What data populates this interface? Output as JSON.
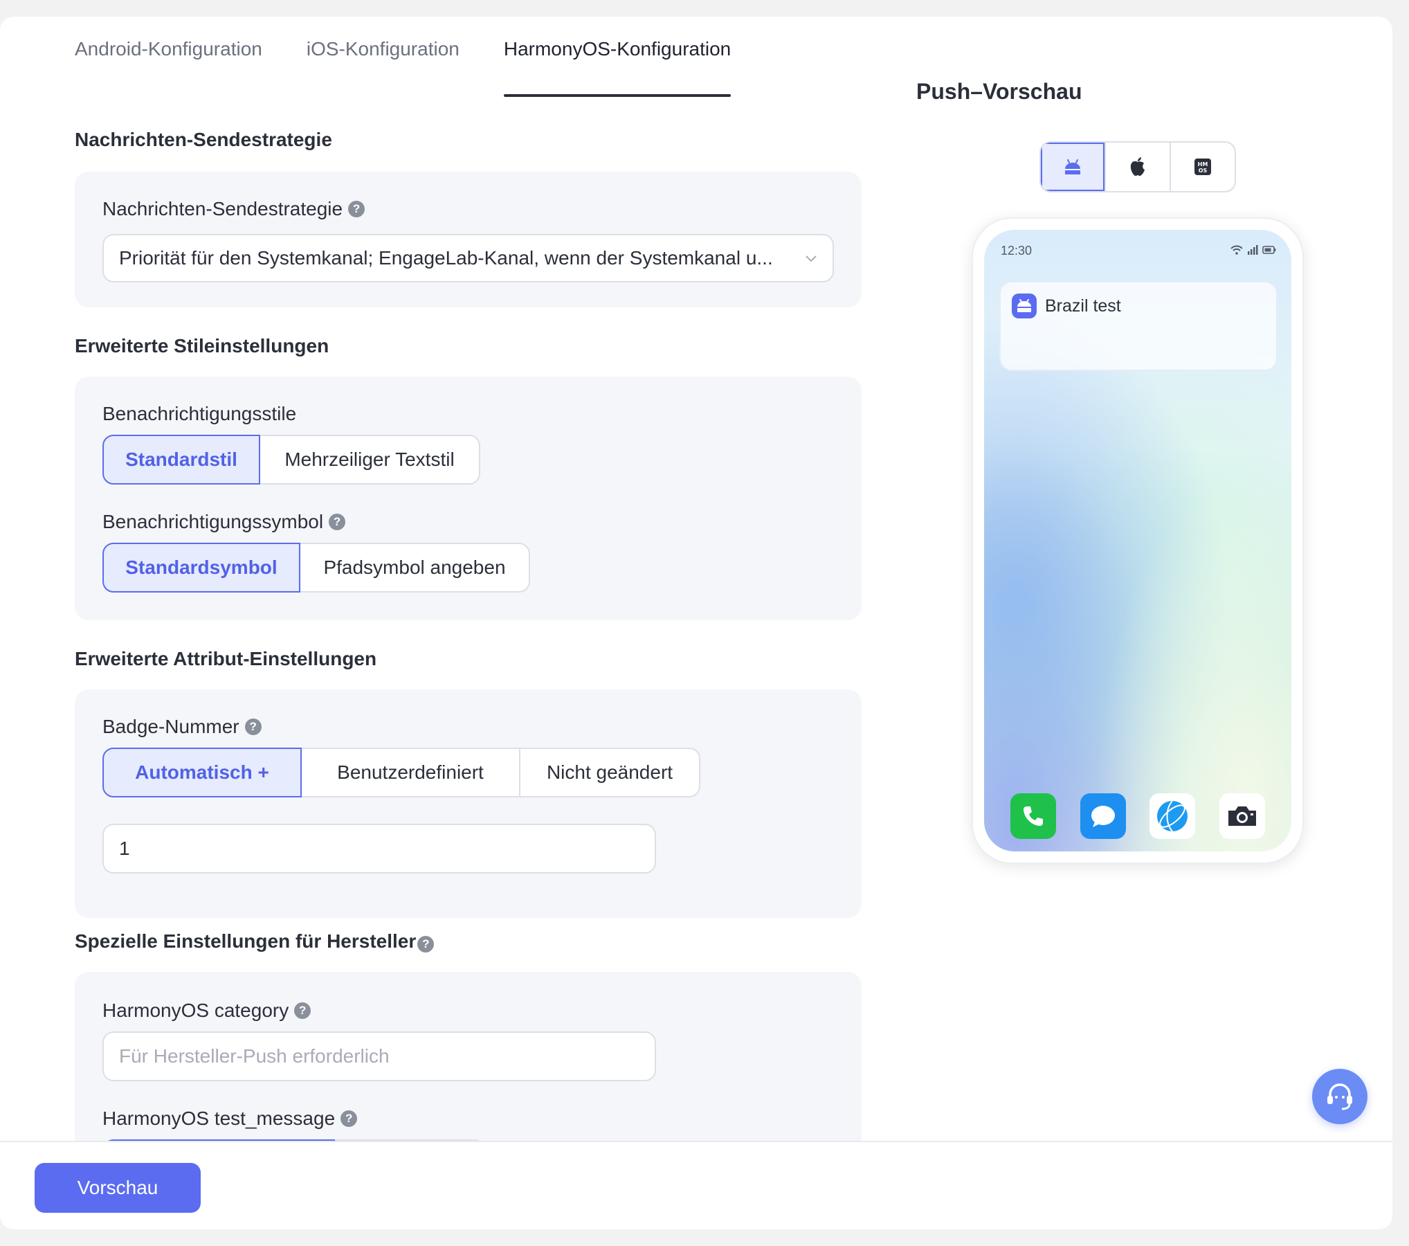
{
  "tabs": [
    {
      "label": "Android-Konfiguration",
      "active": false
    },
    {
      "label": "iOS-Konfiguration",
      "active": false
    },
    {
      "label": "HarmonyOS-Konfiguration",
      "active": true
    }
  ],
  "sections": {
    "strategy": {
      "title": "Nachrichten-Sendestrategie",
      "field_label": "Nachrichten-Sendestrategie",
      "select_value": "Priorität für den Systemkanal; EngageLab-Kanal, wenn der Systemkanal u..."
    },
    "style": {
      "title": "Erweiterte Stileinstellungen",
      "notif_style_label": "Benachrichtigungsstile",
      "notif_style_options": [
        "Standardstil",
        "Mehrzeiliger Textstil"
      ],
      "notif_icon_label": "Benachrichtigungssymbol",
      "notif_icon_options": [
        "Standardsymbol",
        "Pfadsymbol angeben"
      ]
    },
    "attributes": {
      "title": "Erweiterte Attribut-Einstellungen",
      "badge_label": "Badge-Nummer",
      "badge_options": [
        "Automatisch +",
        "Benutzerdefiniert",
        "Nicht geändert"
      ],
      "badge_value": "1"
    },
    "vendor": {
      "title": "Spezielle Einstellungen für Hersteller",
      "category_label": "HarmonyOS category",
      "category_placeholder": "Für Hersteller-Push erforderlich",
      "test_message_label": "HarmonyOS test_message"
    }
  },
  "preview": {
    "title": "Push–Vorschau",
    "os_options": [
      "android-icon",
      "apple-icon",
      "harmonyos-icon"
    ],
    "active_os": "android",
    "status_time": "12:30",
    "notification_title": "Brazil test",
    "dock_apps": [
      "phone-icon",
      "messages-icon",
      "browser-icon",
      "camera-icon"
    ]
  },
  "footer": {
    "preview_button": "Vorschau"
  },
  "colors": {
    "accent": "#5B6CF0",
    "active_segment_bg": "#E6EBFD",
    "panel_bg": "#F5F6FA"
  }
}
